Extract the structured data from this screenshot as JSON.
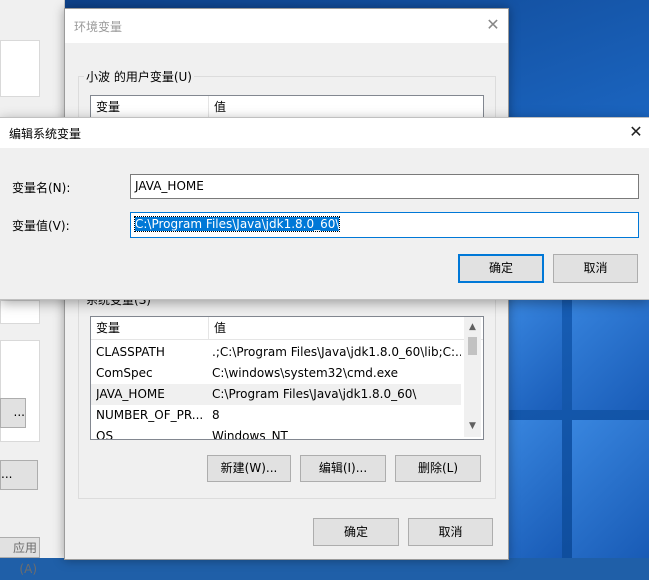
{
  "system_properties": {
    "apply_button": "应用(A)",
    "button_partial_1": "...",
    "button_partial_2": "..."
  },
  "env_window": {
    "title": "环境变量",
    "close_glyph": "✕",
    "user_group_label": "小波 的用户变量(U)",
    "user_list": {
      "headers": [
        "变量",
        "值"
      ]
    },
    "system_group_label": "系统变量(S)",
    "system_list": {
      "headers": [
        "变量",
        "值"
      ],
      "rows": [
        {
          "name": "CLASSPATH",
          "value": ".;C:\\Program Files\\Java\\jdk1.8.0_60\\lib;C:..."
        },
        {
          "name": "ComSpec",
          "value": "C:\\windows\\system32\\cmd.exe"
        },
        {
          "name": "JAVA_HOME",
          "value": "C:\\Program Files\\Java\\jdk1.8.0_60\\"
        },
        {
          "name": "NUMBER_OF_PR...",
          "value": "8"
        },
        {
          "name": "OS",
          "value": "Windows_NT"
        }
      ],
      "selected_row": "JAVA_HOME"
    },
    "system_buttons": {
      "new": "新建(W)...",
      "edit": "编辑(I)...",
      "delete": "删除(L)"
    },
    "ok": "确定",
    "cancel": "取消"
  },
  "edit_dialog": {
    "title": "编辑系统变量",
    "close_glyph": "✕",
    "name_label": "变量名(N):",
    "name_value": "JAVA_HOME",
    "value_label": "变量值(V):",
    "value_value": "C:\\Program Files\\Java\\jdk1.8.0_60\\",
    "ok": "确定",
    "cancel": "取消"
  },
  "colors": {
    "selection": "#0078d7",
    "wallpaper": "#1b65c0"
  }
}
